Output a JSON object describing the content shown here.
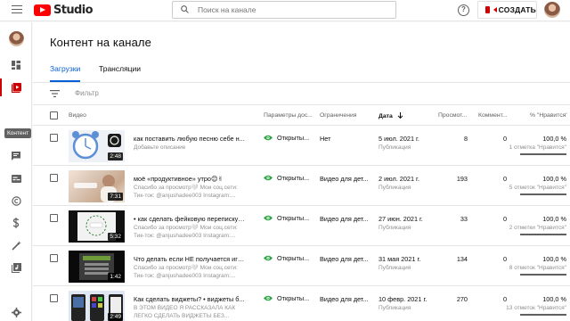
{
  "app": {
    "logo_text": "Studio",
    "brand_color": "#ff0000",
    "accent_color": "#065fd4"
  },
  "search": {
    "placeholder": "Поиск на канале"
  },
  "header": {
    "create_label": "СОЗДАТЬ",
    "help_icon": "?"
  },
  "sidebar": {
    "items": [
      {
        "icon": "dashboard-icon"
      },
      {
        "icon": "content-icon",
        "active": true,
        "tooltip": "Контент"
      },
      {
        "icon": "analytics-icon"
      },
      {
        "icon": "comments-icon"
      },
      {
        "icon": "subtitles-icon"
      },
      {
        "icon": "copyright-icon"
      },
      {
        "icon": "monetization-icon"
      },
      {
        "icon": "customization-icon"
      },
      {
        "icon": "audio-library-icon"
      },
      {
        "icon": "settings-icon"
      }
    ],
    "tooltip": "Контент"
  },
  "main": {
    "title": "Контент на канале",
    "tabs": [
      {
        "label": "Загрузки",
        "active": true
      },
      {
        "label": "Трансляции",
        "active": false
      }
    ],
    "filter_label": "Фильтр",
    "columns": {
      "video": "Видео",
      "visibility": "Параметры дос...",
      "restrictions": "Ограничения",
      "date": "Дата",
      "views": "Просмот...",
      "comments": "Коммент...",
      "likes": "% \"Нравится\""
    },
    "rows": [
      {
        "title": "как поставить любую песню себе н...",
        "desc1": "Добавьте описание",
        "desc2": "",
        "duration": "2:48",
        "visibility": "Открыты...",
        "restriction": "Нет",
        "date": "5 июл. 2021 г.",
        "date_status": "Публикация",
        "views": "8",
        "comments": "0",
        "likes": "100,0 %",
        "likes_count": "1 отметка \"Нравится\""
      },
      {
        "title": "моё «продуктивное» утро😊✌",
        "desc1": "Спасибо за просмотр🤍 Мои соц.сети:",
        "desc2": "Тик-ток: @anjushadee003 Instagram:...",
        "duration": "7:31",
        "visibility": "Открыты...",
        "restriction": "Видео для дет...",
        "date": "2 июл. 2021 г.",
        "date_status": "Публикация",
        "views": "193",
        "comments": "0",
        "likes": "100,0 %",
        "likes_count": "5 отметок \"Нравится\""
      },
      {
        "title": "• как сделать фейковую переписку ...",
        "desc1": "Спасибо за просмотр🤍 Мои соц.сети:",
        "desc2": "Тик-ток: @anjushadee003 Instagram:...",
        "duration": "5:32",
        "visibility": "Открыты...",
        "restriction": "Видео для дет...",
        "date": "27 июн. 2021 г.",
        "date_status": "Публикация",
        "views": "33",
        "comments": "0",
        "likes": "100,0 %",
        "likes_count": "2 отметки \"Нравится\""
      },
      {
        "title": "Что делать если НЕ получается игр...",
        "desc1": "Спасибо за просмотр🤍 Мои соц.сети:",
        "desc2": "Тик-ток: @anjushadee003 Instagram:...",
        "duration": "1:42",
        "visibility": "Открыты...",
        "restriction": "Видео для дет...",
        "date": "31 мая 2021 г.",
        "date_status": "Публикация",
        "views": "134",
        "comments": "0",
        "likes": "100,0 %",
        "likes_count": "8 отметок \"Нравится\""
      },
      {
        "title": "Как сделать виджеты? • виджеты б...",
        "desc1": "В ЭТОМ ВИДЕО Я РАССКАЗАЛА КАК",
        "desc2": "ЛЕГКО СДЕЛАТЬ ВИДЖЕТЫ БЕЗ...",
        "duration": "2:49",
        "visibility": "Открыты...",
        "restriction": "Видео для дет...",
        "date": "10 февр. 2021 г.",
        "date_status": "Публикация",
        "views": "270",
        "comments": "0",
        "likes": "100,0 %",
        "likes_count": "13 отметок \"Нравится\""
      }
    ]
  }
}
